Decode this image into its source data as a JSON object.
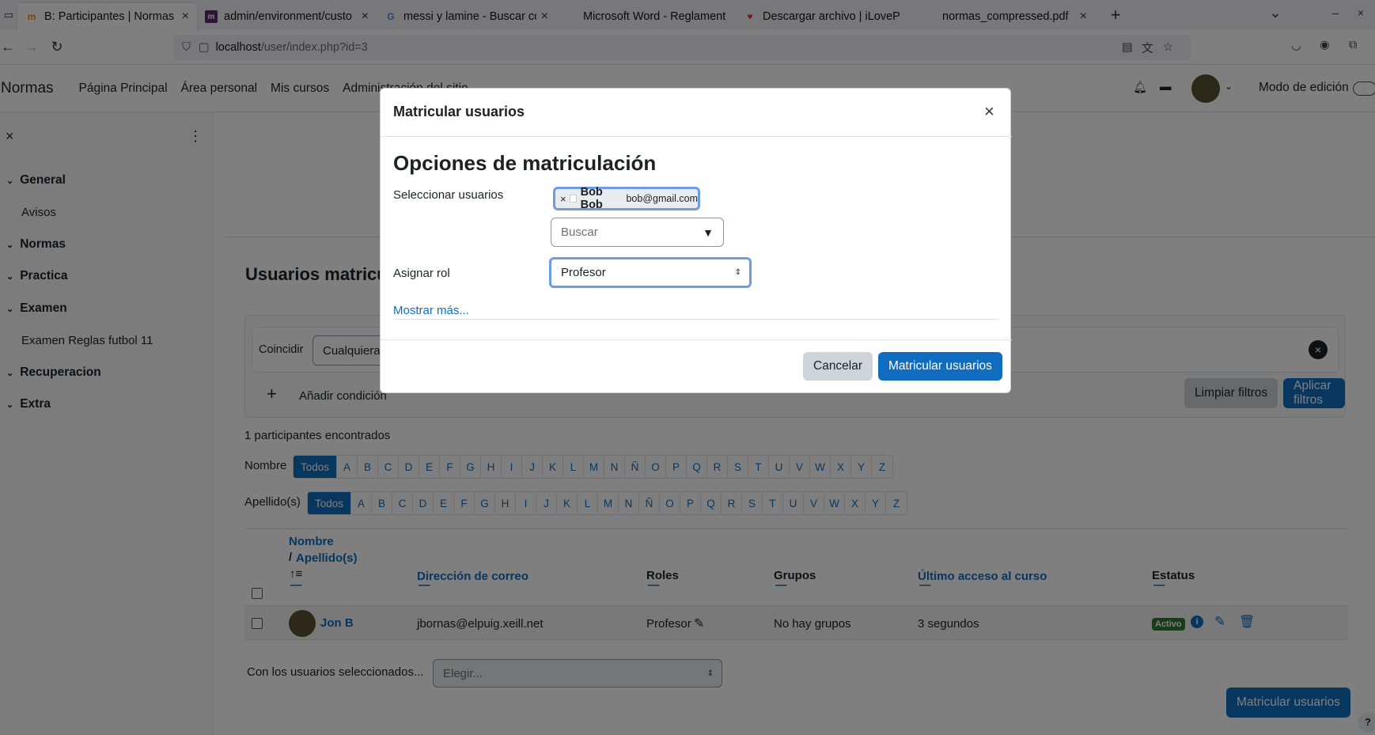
{
  "browser": {
    "tabs": [
      {
        "title": "B: Participantes | Normas",
        "favicon": "moodle-icon"
      },
      {
        "title": "admin/environment/custo",
        "favicon": "moodle-icon"
      },
      {
        "title": "messi y lamine - Buscar co",
        "favicon": "google-icon"
      },
      {
        "title": "Microsoft Word - Reglament",
        "favicon": "word-icon"
      },
      {
        "title": "Descargar archivo | iLoveP",
        "favicon": "ilovepdf-icon"
      },
      {
        "title": "normas_compressed.pdf",
        "favicon": "pdf-icon"
      }
    ],
    "url_host": "localhost",
    "url_path": "/user/index.php?id=3"
  },
  "moodle_nav": {
    "brand": "Normas",
    "links": [
      "Página Principal",
      "Área personal",
      "Mis cursos",
      "Administración del sitio"
    ],
    "edit_mode_label": "Modo de edición"
  },
  "drawer": {
    "sections": [
      {
        "label": "General",
        "items": [
          "Avisos"
        ]
      },
      {
        "label": "Normas",
        "items": []
      },
      {
        "label": "Practica",
        "items": []
      },
      {
        "label": "Examen",
        "items": [
          "Examen Reglas futbol 11"
        ]
      },
      {
        "label": "Recuperacion",
        "items": []
      },
      {
        "label": "Extra",
        "items": []
      }
    ]
  },
  "main": {
    "heading": "Usuarios matriculados",
    "filter": {
      "match_label": "Coincidir",
      "match_value": "Cualquiera",
      "add_condition": "Añadir condición",
      "clear": "Limpiar filtros",
      "apply": "Aplicar filtros"
    },
    "found_text": "1 participantes encontrados",
    "firstname_label": "Nombre",
    "lastname_label": "Apellido(s)",
    "all_label": "Todos",
    "letters": [
      "A",
      "B",
      "C",
      "D",
      "E",
      "F",
      "G",
      "H",
      "I",
      "J",
      "K",
      "L",
      "M",
      "N",
      "Ñ",
      "O",
      "P",
      "Q",
      "R",
      "S",
      "T",
      "U",
      "V",
      "W",
      "X",
      "Y",
      "Z"
    ],
    "table": {
      "col_name": "Nombre",
      "col_lastname": "Apellido(s)",
      "col_email": "Dirección de correo",
      "col_roles": "Roles",
      "col_groups": "Grupos",
      "col_last_access": "Último acceso al curso",
      "col_status": "Estatus",
      "rows": [
        {
          "name": "Jon B",
          "email": "jbornas@elpuig.xeill.net",
          "role": "Profesor",
          "groups": "No hay grupos",
          "last_access": "3 segundos",
          "status": "Activo"
        }
      ]
    },
    "bulk_label": "Con los usuarios seleccionados...",
    "bulk_placeholder": "Elegir...",
    "enrol_button": "Matricular usuarios"
  },
  "modal": {
    "title": "Matricular usuarios",
    "section_heading": "Opciones de matriculación",
    "select_users_label": "Seleccionar usuarios",
    "selected_user_name": "Bob Bob",
    "selected_user_email": "bob@gmail.com",
    "search_placeholder": "Buscar",
    "role_label": "Asignar rol",
    "role_value": "Profesor",
    "show_more": "Mostrar más...",
    "cancel": "Cancelar",
    "submit": "Matricular usuarios"
  },
  "colors": {
    "primary": "#0f6cbf",
    "success": "#357a32"
  }
}
